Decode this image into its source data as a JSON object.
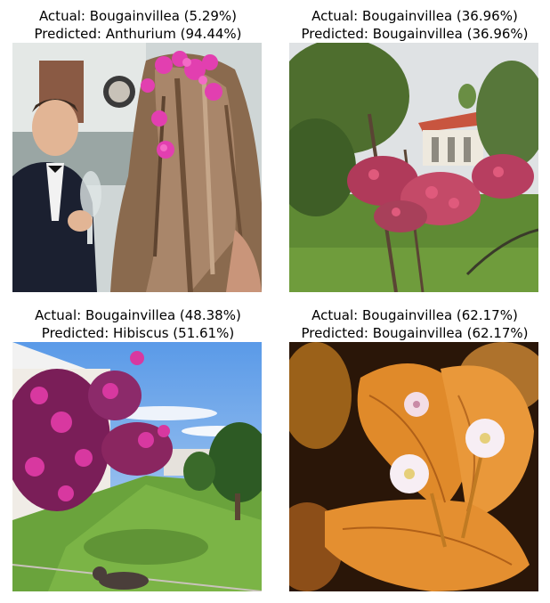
{
  "panels": [
    {
      "actual": "Actual: Bougainvillea (5.29%)",
      "predicted": "Predicted: Anthurium (94.44%)"
    },
    {
      "actual": "Actual: Bougainvillea (36.96%)",
      "predicted": "Predicted: Bougainvillea (36.96%)"
    },
    {
      "actual": "Actual: Bougainvillea (48.38%)",
      "predicted": "Predicted: Hibiscus (51.61%)"
    },
    {
      "actual": "Actual: Bougainvillea (62.17%)",
      "predicted": "Predicted: Bougainvillea (62.17%)"
    }
  ]
}
